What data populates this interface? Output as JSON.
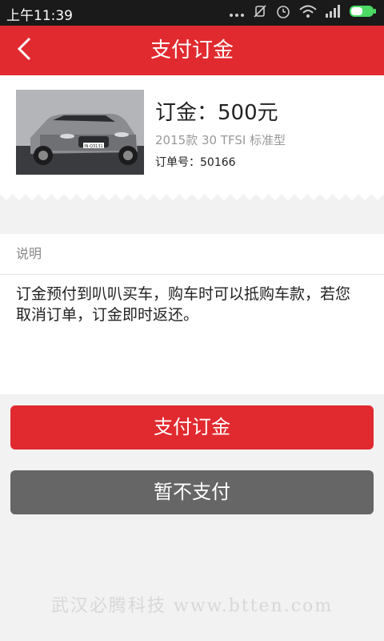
{
  "statusbar": {
    "time": "上午11:39",
    "icons": [
      "more-dots-icon",
      "mute-icon",
      "alarm-icon",
      "wifi-icon",
      "signal-icon",
      "battery-icon"
    ]
  },
  "navbar": {
    "title": "支付订金",
    "back_icon": "chevron-left-icon"
  },
  "order": {
    "deposit": "订金：500元",
    "model": "2015款 30 TFSI 标准型",
    "order_number": "订单号：50166",
    "plate": "IN·Q3131"
  },
  "description": {
    "header": "说明",
    "text": "订金预付到叭叭买车，购车时可以抵购车款，若您取消订单，订金即时返还。"
  },
  "buttons": {
    "pay": "支付订金",
    "cancel": "暂不支付"
  },
  "watermark": "武汉必腾科技 www.btten.com",
  "colors": {
    "accent": "#e12a2f",
    "secondary_button": "#666666",
    "statusbar": "#1a1a1a"
  }
}
